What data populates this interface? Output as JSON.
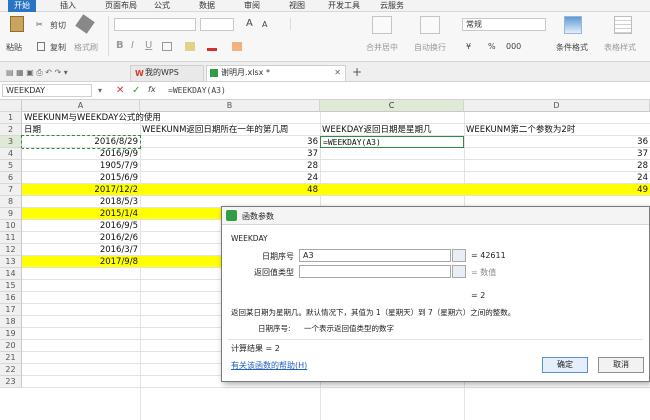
{
  "menu": [
    "开始",
    "插入",
    "页面布局",
    "公式",
    "数据",
    "审阅",
    "视图",
    "开发工具",
    "云服务"
  ],
  "ribbon": {
    "paste": "粘贴",
    "cut": "剪切",
    "copy": "复制",
    "format_painter": "格式刷",
    "bold": "B",
    "italic": "I",
    "underline": "U",
    "merge_center": "合并居中",
    "wrap_text": "自动换行",
    "number_format": "常规",
    "currency": "¥",
    "percent": "%",
    "thousands": "000",
    "cond_format": "条件格式",
    "table_style": "表格样式",
    "font_size_up": "A",
    "font_size_down": "A"
  },
  "tabs": {
    "wps": "我的WPS",
    "file": "谢明月.xlsx *",
    "add": "+"
  },
  "formula_bar": {
    "name_box": "WEEKDAY",
    "cancel": "✕",
    "confirm": "✓",
    "fx": "fx",
    "formula": "=WEEKDAY(A3)"
  },
  "columns": [
    "A",
    "B",
    "C",
    "D"
  ],
  "rows": [
    {
      "n": "1",
      "a": "WEEKUNM与WEEKDAY公式的使用",
      "b": "",
      "c": "",
      "d": "",
      "yellow": false
    },
    {
      "n": "2",
      "a": "日期",
      "b": "WEEKUNM返回日期所在一年的第几周",
      "c": "WEEKDAY返回日期是星期几",
      "d": "WEEKUNM第二个参数为2时",
      "yellow": false
    },
    {
      "n": "3",
      "a": "2016/8/29",
      "b": "36",
      "c": "=WEEKDAY(A3)",
      "d": "36",
      "yellow": false
    },
    {
      "n": "4",
      "a": "2016/9/9",
      "b": "37",
      "c": "",
      "d": "37",
      "yellow": false
    },
    {
      "n": "5",
      "a": "1905/7/9",
      "b": "28",
      "c": "",
      "d": "28",
      "yellow": false
    },
    {
      "n": "6",
      "a": "2015/6/9",
      "b": "24",
      "c": "",
      "d": "24",
      "yellow": false
    },
    {
      "n": "7",
      "a": "2017/12/2",
      "b": "48",
      "c": "",
      "d": "49",
      "yellow": true
    },
    {
      "n": "8",
      "a": "2018/5/3",
      "b": "",
      "c": "",
      "d": "",
      "yellow": false
    },
    {
      "n": "9",
      "a": "2015/1/4",
      "b": "",
      "c": "",
      "d": "",
      "yellow": true
    },
    {
      "n": "10",
      "a": "2016/9/5",
      "b": "",
      "c": "",
      "d": "",
      "yellow": false
    },
    {
      "n": "11",
      "a": "2016/2/6",
      "b": "",
      "c": "",
      "d": "",
      "yellow": false
    },
    {
      "n": "12",
      "a": "2016/3/7",
      "b": "",
      "c": "",
      "d": "",
      "yellow": false
    },
    {
      "n": "13",
      "a": "2017/9/8",
      "b": "",
      "c": "",
      "d": "",
      "yellow": true
    },
    {
      "n": "14",
      "a": "",
      "b": "",
      "c": "",
      "d": "",
      "yellow": false
    },
    {
      "n": "15",
      "a": "",
      "b": "",
      "c": "",
      "d": "",
      "yellow": false
    },
    {
      "n": "16",
      "a": "",
      "b": "",
      "c": "",
      "d": "",
      "yellow": false
    },
    {
      "n": "17",
      "a": "",
      "b": "",
      "c": "",
      "d": "",
      "yellow": false
    },
    {
      "n": "18",
      "a": "",
      "b": "",
      "c": "",
      "d": "",
      "yellow": false
    },
    {
      "n": "19",
      "a": "",
      "b": "",
      "c": "",
      "d": "",
      "yellow": false
    },
    {
      "n": "20",
      "a": "",
      "b": "",
      "c": "",
      "d": "",
      "yellow": false
    },
    {
      "n": "21",
      "a": "",
      "b": "",
      "c": "",
      "d": "",
      "yellow": false
    },
    {
      "n": "22",
      "a": "",
      "b": "",
      "c": "",
      "d": "",
      "yellow": false
    },
    {
      "n": "23",
      "a": "",
      "b": "",
      "c": "",
      "d": "",
      "yellow": false
    }
  ],
  "dialog": {
    "title": "函数参数",
    "func_name": "WEEKDAY",
    "arg1_label": "日期序号",
    "arg1_value": "A3",
    "arg1_result": "= 42611",
    "arg2_label": "返回值类型",
    "arg2_value": "",
    "arg2_result": "= 数值",
    "eq_result": "= 2",
    "description": "返回某日期为星期几。默认情况下，其值为 1（星期天）到 7（星期六）之间的整数。",
    "param_help_label": "日期序号:",
    "param_help_text": "一个表示返回值类型的数字",
    "calc_result": "计算结果 = 2",
    "help_link": "有关该函数的帮助(H)",
    "ok": "确定",
    "cancel": "取消"
  },
  "colors": {
    "accent": "#2a74c5",
    "highlight_yellow": "#ffff00",
    "selected_header": "#dfe9d6"
  }
}
